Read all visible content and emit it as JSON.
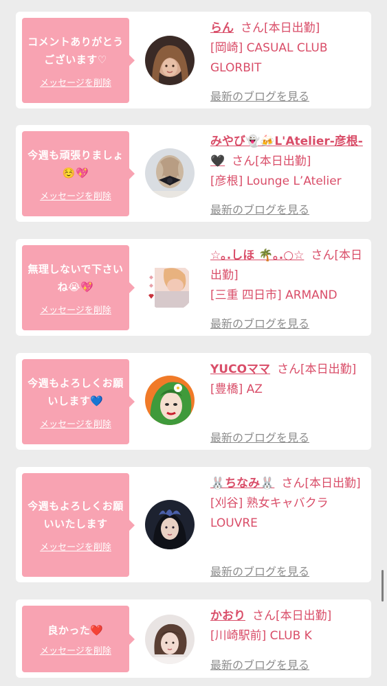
{
  "cards": [
    {
      "message": "コメントありがとうございます♡",
      "delete_label": "メッセージを削除",
      "name": "らん",
      "san_status": "さん[本日出勤]",
      "shop": "[岡崎] CASUAL CLUB GLORBIT",
      "blog_label": "最新のブログを見る"
    },
    {
      "message": "今週も頑張りましょ☺️💖",
      "delete_label": "メッセージを削除",
      "name": "みやび👻🍻L'Atelier-彦根-🖤",
      "san_status": "さん[本日出勤]",
      "shop": "[彦根] Lounge L’Atelier",
      "blog_label": "最新のブログを見る"
    },
    {
      "message": "無理しないで下さいね😭💖",
      "delete_label": "メッセージを削除",
      "name": "☆｡.しほ 🌴｡.○☆",
      "san_status": "さん[本日出勤]",
      "shop": "[三重 四日市] ARMAND",
      "blog_label": "最新のブログを見る"
    },
    {
      "message": "今週もよろしくお願いします💙",
      "delete_label": "メッセージを削除",
      "name": "YUCOママ",
      "san_status": "さん[本日出勤]",
      "shop": "[豊橋] AZ",
      "blog_label": "最新のブログを見る"
    },
    {
      "message": "今週もよろしくお願いいたします",
      "delete_label": "メッセージを削除",
      "name": "🐰ちなみ🐰",
      "san_status": "さん[本日出勤]",
      "shop": "[刈谷] 熟女キャバクラ LOUVRE",
      "blog_label": "最新のブログを見る"
    },
    {
      "message": "良かった❤️",
      "delete_label": "メッセージを削除",
      "name": "かおり",
      "san_status": "さん[本日出勤]",
      "shop": "[川崎駅前] CLUB K",
      "blog_label": "最新のブログを見る"
    }
  ],
  "colors": {
    "background": "#ececec",
    "card": "#ffffff",
    "bubble": "#f8a3b2",
    "accent_text": "#d94d68",
    "link_gray": "#8c8c8c"
  }
}
